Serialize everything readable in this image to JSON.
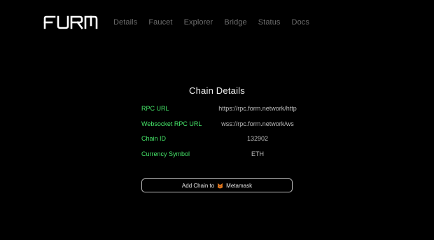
{
  "brand": {
    "logo_text": "FORM"
  },
  "nav": {
    "items": [
      {
        "label": "Details"
      },
      {
        "label": "Faucet"
      },
      {
        "label": "Explorer"
      },
      {
        "label": "Bridge"
      },
      {
        "label": "Status"
      },
      {
        "label": "Docs"
      }
    ]
  },
  "chain": {
    "title": "Chain Details",
    "rows": [
      {
        "label": "RPC URL",
        "value": "https://rpc.form.network/http"
      },
      {
        "label": "Websocket RPC URL",
        "value": "wss://rpc.form.network/ws"
      },
      {
        "label": "Chain ID",
        "value": "132902"
      },
      {
        "label": "Currency Symbol",
        "value": "ETH"
      }
    ]
  },
  "add_chain": {
    "prefix": "Add Chain to",
    "wallet": "Metamask",
    "wallet_icon": "metamask-fox-icon"
  },
  "colors": {
    "background": "#000000",
    "accent_green": "#46e86a",
    "nav_text": "#6e6e6e",
    "value_text": "#bdbdbd"
  }
}
